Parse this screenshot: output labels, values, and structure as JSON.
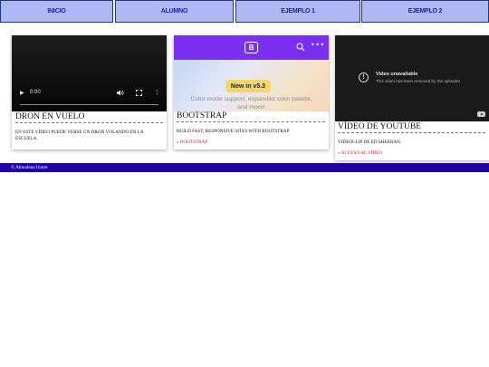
{
  "nav": {
    "items": [
      {
        "label": "INICIO"
      },
      {
        "label": "ALUMNO"
      },
      {
        "label": "EJEMPLO 1"
      },
      {
        "label": "EJEMPLO 2"
      }
    ]
  },
  "cards": [
    {
      "title": "DRON EN VUELO",
      "text": "EN ESTE VÍDEO PUEDE VERSE UN DRON VOLANDO EN LA ESCUELA.",
      "video": {
        "time": "0:00"
      }
    },
    {
      "title": "BOOTSTRAP",
      "text": "BUILD FAST, RESPONSIVE SITES WITH BOOTSTRAP",
      "link": "» BOOTSTRAP",
      "banner": {
        "logo": "B",
        "badge": "New in v5.3",
        "tagline": "Color mode support, expanded color palette, and more!"
      }
    },
    {
      "title": "VÍDEO DE YOUTUBE",
      "text": "VIDEOCLIP DE ED SHEERAN.",
      "link": "» ACCESO AL VÍDEO",
      "video": {
        "unavailable_title": "Video unavailable",
        "unavailable_message": "This video has been removed by the uploader"
      }
    }
  ],
  "footer": {
    "text": "© Almudena Iriarte"
  },
  "colors": {
    "nav_background": "#aeb9f3",
    "nav_text": "#1c1fa0",
    "footer_background": "#1f00a6",
    "link": "#d11a1a",
    "bootstrap_purple": "#7b2ff2",
    "badge_yellow": "#f5d66b"
  },
  "icons": [
    "play-icon",
    "volume-icon",
    "fullscreen-icon",
    "more-options-icon",
    "bootstrap-logo-icon",
    "search-icon",
    "alert-circle-icon",
    "youtube-icon"
  ]
}
